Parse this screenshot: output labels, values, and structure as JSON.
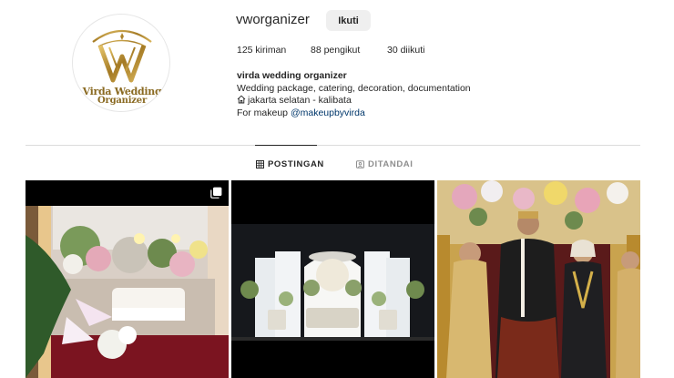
{
  "profile": {
    "username": "vworganizer",
    "follow_label": "Ikuti",
    "avatar": {
      "logo_line1": "Virda Wedding",
      "logo_line2": "Organizer"
    },
    "stats": {
      "posts": "125 kiriman",
      "followers": "88 pengikut",
      "following": "30 diikuti"
    },
    "bio": {
      "name": "virda wedding organizer",
      "line1": "Wedding package, catering, decoration, documentation",
      "line2": "jakarta selatan - kalibata",
      "line2_icon": "house-icon",
      "line3_prefix": "For makeup",
      "line3_mention": "@makeupbyvirda"
    }
  },
  "tabs": [
    {
      "label": "POSTINGAN",
      "icon": "grid-icon",
      "active": true
    },
    {
      "label": "DITANDAI",
      "icon": "tag-icon",
      "active": false
    }
  ],
  "posts": [
    {
      "subject": "wedding decoration with white chair and flowers",
      "icon": "carousel-icon"
    },
    {
      "subject": "white wedding stage decoration"
    },
    {
      "subject": "bride and groom with family in traditional attire"
    }
  ],
  "colors": {
    "text": "#262626",
    "muted": "#8e8e8e",
    "link": "#00376b",
    "button_bg": "#efefef",
    "gold": "#8a6a22"
  }
}
